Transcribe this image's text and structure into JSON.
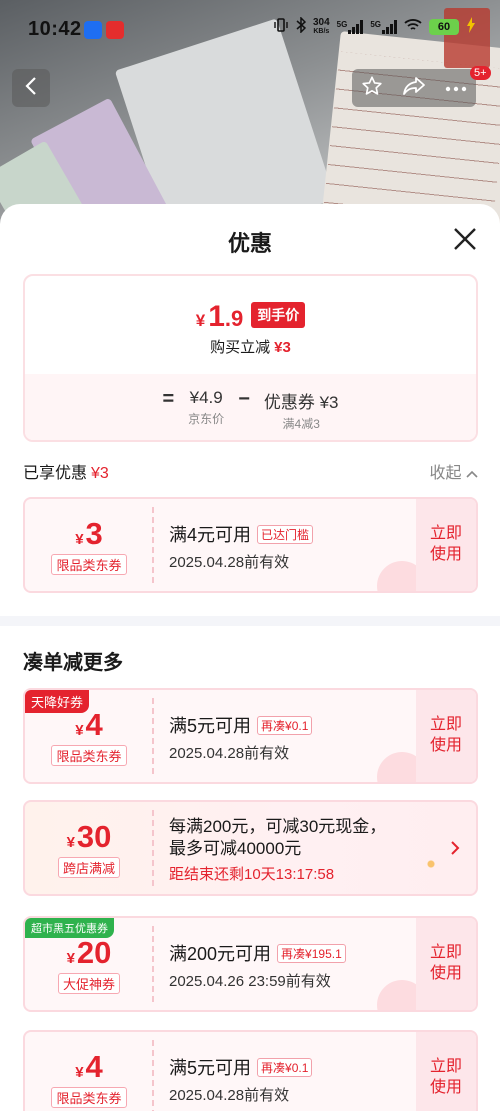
{
  "status_bar": {
    "time": "10:42",
    "net_speed": "304",
    "net_unit": "KB/s",
    "signal1": "5G",
    "signal2": "5G",
    "battery": "60"
  },
  "header": {
    "badge": "5+"
  },
  "sheet": {
    "title": "优惠",
    "summary": {
      "price_symbol": "¥",
      "price_int": "1",
      "price_dec": ".9",
      "final_tag": "到手价",
      "instant_label": "购买立减",
      "instant_value": "¥3",
      "eq": "=",
      "base_price": "¥4.9",
      "base_label": "京东价",
      "minus": "−",
      "coupon_price": "优惠券 ¥3",
      "coupon_rule": "满4减3"
    },
    "enjoyed_label": "已享优惠",
    "enjoyed_value": "¥3",
    "collapse_label": "收起",
    "coupons_enjoyed": [
      {
        "amount_symbol": "¥",
        "amount": "3",
        "kind": "限品类东券",
        "condition": "满4元可用",
        "chip": "已达门槛",
        "valid": "2025.04.28前有效",
        "use": "立即使用"
      }
    ],
    "more_title": "凑单减更多",
    "coupons_more": [
      {
        "corner": "天降好券",
        "amount_symbol": "¥",
        "amount": "4",
        "kind": "限品类东券",
        "condition": "满5元可用",
        "chip": "再凑¥0.1",
        "valid": "2025.04.28前有效",
        "use": "立即使用"
      },
      {
        "corner": "超市黑五优惠券",
        "amount_symbol": "¥",
        "amount": "20",
        "kind": "大促神券",
        "condition": "满200元可用",
        "chip": "再凑¥195.1",
        "valid": "2025.04.26 23:59前有效",
        "use": "立即使用"
      },
      {
        "amount_symbol": "¥",
        "amount": "4",
        "kind": "限品类东券",
        "condition": "满5元可用",
        "chip": "再凑¥0.1",
        "valid": "2025.04.28前有效",
        "use": "立即使用"
      }
    ],
    "promo": {
      "amount_symbol": "¥",
      "amount": "30",
      "kind": "跨店满减",
      "desc_line1": "每满200元，可减30元现金，",
      "desc_line2": "最多可减40000元",
      "countdown": "距结束还剩10天13:17:58"
    }
  },
  "colors": {
    "accent": "#e4232e",
    "coupon_bg": "#fff7f8",
    "use_bg": "#fde6ea",
    "badge_green": "#2fb24d"
  }
}
